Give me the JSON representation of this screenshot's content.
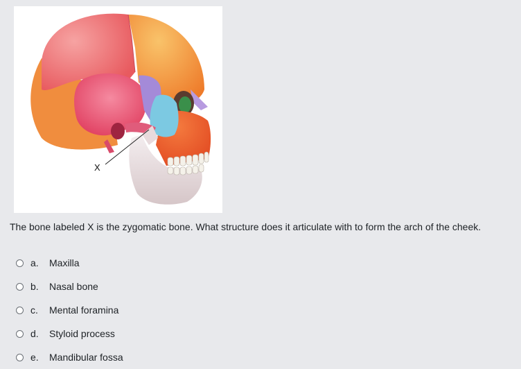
{
  "figure": {
    "label": "X"
  },
  "question": {
    "text": "The bone labeled X is the zygomatic bone. What structure does it articulate with to form the arch of the cheek."
  },
  "answers": [
    {
      "letter": "a.",
      "text": "Maxilla"
    },
    {
      "letter": "b.",
      "text": "Nasal bone"
    },
    {
      "letter": "c.",
      "text": "Mental foramina"
    },
    {
      "letter": "d.",
      "text": "Styloid process"
    },
    {
      "letter": "e.",
      "text": "Mandibular fossa"
    }
  ],
  "colors": {
    "page_background": "#e8e9ec",
    "text": "#1d2125",
    "figure_background": "#ffffff",
    "parietal": "#ee6567",
    "frontal": "#f4a13c",
    "temporal": "#e8486a",
    "sphenoid": "#a48ad8",
    "zygomatic": "#7cc9e2",
    "maxilla": "#ec5a2e",
    "mandible": "#ece2e3"
  }
}
